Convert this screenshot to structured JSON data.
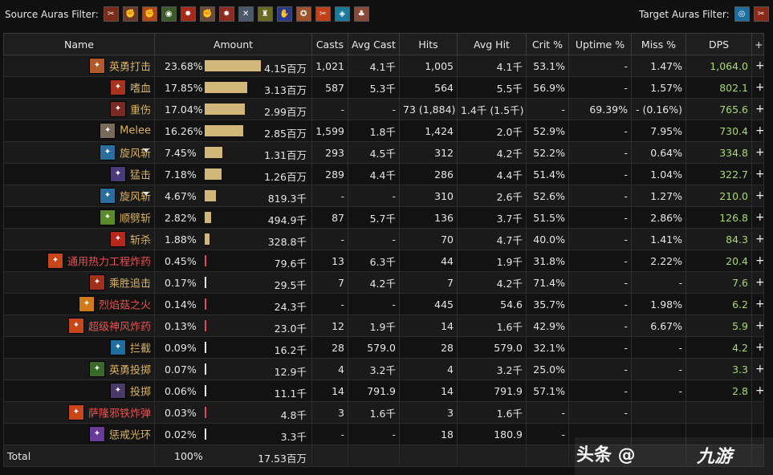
{
  "filters": {
    "source_label": "Source Auras Filter:",
    "target_label": "Target Auras Filter:",
    "source_icons": [
      {
        "name": "claw-slash-icon",
        "color": "#7a2b1a"
      },
      {
        "name": "fist-icon",
        "color": "#6b3a2a"
      },
      {
        "name": "flaming-fist-icon",
        "color": "#b0481a"
      },
      {
        "name": "shout-icon",
        "color": "#3d5a2a"
      },
      {
        "name": "enrage-icon",
        "color": "#a52a1a"
      },
      {
        "name": "arm-icon",
        "color": "#6b4a3a"
      },
      {
        "name": "berserker-icon",
        "color": "#8e2a20"
      },
      {
        "name": "crossed-axes-icon",
        "color": "#4a5a6a"
      },
      {
        "name": "battle-stance-icon",
        "color": "#6a6a20"
      },
      {
        "name": "mage-hand-icon",
        "color": "#2a3a8a"
      },
      {
        "name": "heroism-icon",
        "color": "#a0522d"
      },
      {
        "name": "fire-slash-icon",
        "color": "#c0401a"
      },
      {
        "name": "rune-icon",
        "color": "#1a7a9a"
      },
      {
        "name": "totem-icon",
        "color": "#8a4a3a"
      }
    ],
    "target_icons": [
      {
        "name": "whirlwind-icon",
        "color": "#1f6ea0"
      },
      {
        "name": "bleed-icon",
        "color": "#8a2a1a"
      }
    ]
  },
  "columns": [
    "Name",
    "Amount",
    "Casts",
    "Avg Cast",
    "Hits",
    "Avg Hit",
    "Crit %",
    "Uptime %",
    "Miss %",
    "DPS",
    "+"
  ],
  "colors": {
    "bar": "#d2b77b",
    "item_bar": "#e0465c",
    "dps": "#a8d86e",
    "warrior": "#d9b25f",
    "item": "#ee4f4f"
  },
  "rows": [
    {
      "name": "英勇打击",
      "cls": "c-warrior",
      "icon": "heroic-strike-icon",
      "icon_color": "#b35a2a",
      "arrow": false,
      "pct": "23.68%",
      "bar": 0.2368,
      "amount": "4.15百万",
      "casts": "1,021",
      "avg_cast": "4.1千",
      "hits": "1,005",
      "avg_hit": "4.1千",
      "crit": "53.1%",
      "uptime": "-",
      "miss": "1.47%",
      "dps": "1,064.0",
      "plus": "+"
    },
    {
      "name": "嗜血",
      "cls": "c-warrior",
      "icon": "bloodthirst-icon",
      "icon_color": "#a8321e",
      "arrow": false,
      "pct": "17.85%",
      "bar": 0.1785,
      "amount": "3.13百万",
      "casts": "587",
      "avg_cast": "5.3千",
      "hits": "564",
      "avg_hit": "5.5千",
      "crit": "56.9%",
      "uptime": "-",
      "miss": "1.57%",
      "dps": "802.1",
      "plus": "+"
    },
    {
      "name": "重伤",
      "cls": "c-warrior",
      "icon": "deep-wounds-icon",
      "icon_color": "#7a2a22",
      "arrow": false,
      "pct": "17.04%",
      "bar": 0.1704,
      "amount": "2.99百万",
      "casts": "-",
      "avg_cast": "-",
      "hits": "73 (1,884)",
      "avg_hit": "1.4千 (1.5千)",
      "crit": "-",
      "uptime": "69.39%",
      "miss": "- (0.16%)",
      "dps": "765.6",
      "plus": "+"
    },
    {
      "name": "Melee",
      "cls": "c-melee",
      "icon": "melee-swords-icon",
      "icon_color": "#7a6a5a",
      "arrow": false,
      "pct": "16.26%",
      "bar": 0.1626,
      "amount": "2.85百万",
      "casts": "1,599",
      "avg_cast": "1.8千",
      "hits": "1,424",
      "avg_hit": "2.0千",
      "crit": "52.9%",
      "uptime": "-",
      "miss": "7.95%",
      "dps": "730.4",
      "plus": "+"
    },
    {
      "name": "旋风斩",
      "cls": "c-warrior",
      "icon": "whirlwind-icon",
      "icon_color": "#2a6ea0",
      "arrow": true,
      "pct": "7.45%",
      "bar": 0.0745,
      "amount": "1.31百万",
      "casts": "293",
      "avg_cast": "4.5千",
      "hits": "312",
      "avg_hit": "4.2千",
      "crit": "52.2%",
      "uptime": "-",
      "miss": "0.64%",
      "dps": "334.8",
      "plus": "+"
    },
    {
      "name": "猛击",
      "cls": "c-warrior",
      "icon": "slam-icon",
      "icon_color": "#4a3a7a",
      "arrow": false,
      "pct": "7.18%",
      "bar": 0.0718,
      "amount": "1.26百万",
      "casts": "289",
      "avg_cast": "4.4千",
      "hits": "286",
      "avg_hit": "4.4千",
      "crit": "51.4%",
      "uptime": "-",
      "miss": "1.04%",
      "dps": "322.7",
      "plus": "+"
    },
    {
      "name": "旋风斩",
      "cls": "c-warrior",
      "icon": "whirlwind-icon",
      "icon_color": "#2a6ea0",
      "arrow": true,
      "pct": "4.67%",
      "bar": 0.0467,
      "amount": "819.3千",
      "casts": "-",
      "avg_cast": "-",
      "hits": "310",
      "avg_hit": "2.6千",
      "crit": "52.6%",
      "uptime": "-",
      "miss": "1.27%",
      "dps": "210.0",
      "plus": "+"
    },
    {
      "name": "顺劈斩",
      "cls": "c-warrior",
      "icon": "cleave-icon",
      "icon_color": "#5a8a2a",
      "arrow": false,
      "pct": "2.82%",
      "bar": 0.0282,
      "amount": "494.9千",
      "casts": "87",
      "avg_cast": "5.7千",
      "hits": "136",
      "avg_hit": "3.7千",
      "crit": "51.5%",
      "uptime": "-",
      "miss": "2.86%",
      "dps": "126.8",
      "plus": "+"
    },
    {
      "name": "斩杀",
      "cls": "c-warrior",
      "icon": "execute-icon",
      "icon_color": "#b8281a",
      "arrow": false,
      "pct": "1.88%",
      "bar": 0.0188,
      "amount": "328.8千",
      "casts": "-",
      "avg_cast": "-",
      "hits": "70",
      "avg_hit": "4.7千",
      "crit": "40.0%",
      "uptime": "-",
      "miss": "1.41%",
      "dps": "84.3",
      "plus": "+"
    },
    {
      "name": "通用热力工程炸药",
      "cls": "c-item",
      "icon": "explosive-icon",
      "icon_color": "#c8461a",
      "arrow": false,
      "pct": "0.45%",
      "bar": 0.0045,
      "amount": "79.6千",
      "casts": "13",
      "avg_cast": "6.3千",
      "hits": "44",
      "avg_hit": "1.9千",
      "crit": "31.8%",
      "uptime": "-",
      "miss": "2.22%",
      "dps": "20.4",
      "plus": "+"
    },
    {
      "name": "乘胜追击",
      "cls": "c-warrior",
      "icon": "victory-rush-icon",
      "icon_color": "#a0301a",
      "arrow": false,
      "pct": "0.17%",
      "bar": 0.0017,
      "amount": "29.5千",
      "casts": "7",
      "avg_cast": "4.2千",
      "hits": "7",
      "avg_hit": "4.2千",
      "crit": "71.4%",
      "uptime": "-",
      "miss": "-",
      "dps": "7.6",
      "plus": "+"
    },
    {
      "name": "烈焰菇之火",
      "cls": "c-item",
      "icon": "mushroom-fire-icon",
      "icon_color": "#d07a1a",
      "arrow": false,
      "pct": "0.14%",
      "bar": 0.0014,
      "amount": "24.3千",
      "casts": "-",
      "avg_cast": "-",
      "hits": "445",
      "avg_hit": "54.6",
      "crit": "35.7%",
      "uptime": "-",
      "miss": "1.98%",
      "dps": "6.2",
      "plus": "+"
    },
    {
      "name": "超级神风炸药",
      "cls": "c-item",
      "icon": "bomb-icon",
      "icon_color": "#c8461a",
      "arrow": false,
      "pct": "0.13%",
      "bar": 0.0013,
      "amount": "23.0千",
      "casts": "12",
      "avg_cast": "1.9千",
      "hits": "14",
      "avg_hit": "1.6千",
      "crit": "42.9%",
      "uptime": "-",
      "miss": "6.67%",
      "dps": "5.9",
      "plus": "+"
    },
    {
      "name": "拦截",
      "cls": "c-warrior",
      "icon": "intercept-icon",
      "icon_color": "#1f6ea0",
      "arrow": false,
      "pct": "0.09%",
      "bar": 0.0009,
      "amount": "16.2千",
      "casts": "28",
      "avg_cast": "579.0",
      "hits": "28",
      "avg_hit": "579.0",
      "crit": "32.1%",
      "uptime": "-",
      "miss": "-",
      "dps": "4.2",
      "plus": "+"
    },
    {
      "name": "英勇投掷",
      "cls": "c-warrior",
      "icon": "heroic-throw-icon",
      "icon_color": "#3a6a2a",
      "arrow": false,
      "pct": "0.07%",
      "bar": 0.0007,
      "amount": "12.9千",
      "casts": "4",
      "avg_cast": "3.2千",
      "hits": "4",
      "avg_hit": "3.2千",
      "crit": "25.0%",
      "uptime": "-",
      "miss": "-",
      "dps": "3.3",
      "plus": "+"
    },
    {
      "name": "投掷",
      "cls": "c-warrior",
      "icon": "throw-icon",
      "icon_color": "#4a3a6a",
      "arrow": false,
      "pct": "0.06%",
      "bar": 0.0006,
      "amount": "11.1千",
      "casts": "14",
      "avg_cast": "791.9",
      "hits": "14",
      "avg_hit": "791.9",
      "crit": "57.1%",
      "uptime": "-",
      "miss": "-",
      "dps": "2.8",
      "plus": "+"
    },
    {
      "name": "萨隆邪铁炸弹",
      "cls": "c-item",
      "icon": "saronite-bomb-icon",
      "icon_color": "#c8461a",
      "arrow": false,
      "pct": "0.03%",
      "bar": 0.0003,
      "amount": "4.8千",
      "casts": "3",
      "avg_cast": "1.6千",
      "hits": "3",
      "avg_hit": "1.6千",
      "crit": "-",
      "uptime": "-",
      "miss": "",
      "dps": "",
      "plus": ""
    },
    {
      "name": "惩戒光环",
      "cls": "c-warrior",
      "icon": "retribution-aura-icon",
      "icon_color": "#6a3a9a",
      "arrow": false,
      "pct": "0.02%",
      "bar": 0.0002,
      "amount": "3.3千",
      "casts": "-",
      "avg_cast": "-",
      "hits": "18",
      "avg_hit": "180.9",
      "crit": "-",
      "uptime": "",
      "miss": "",
      "dps": "",
      "plus": ""
    }
  ],
  "total": {
    "label": "Total",
    "pct": "100%",
    "amount": "17.53百万"
  },
  "watermark": {
    "text": "头条 @",
    "logo": "九游"
  }
}
